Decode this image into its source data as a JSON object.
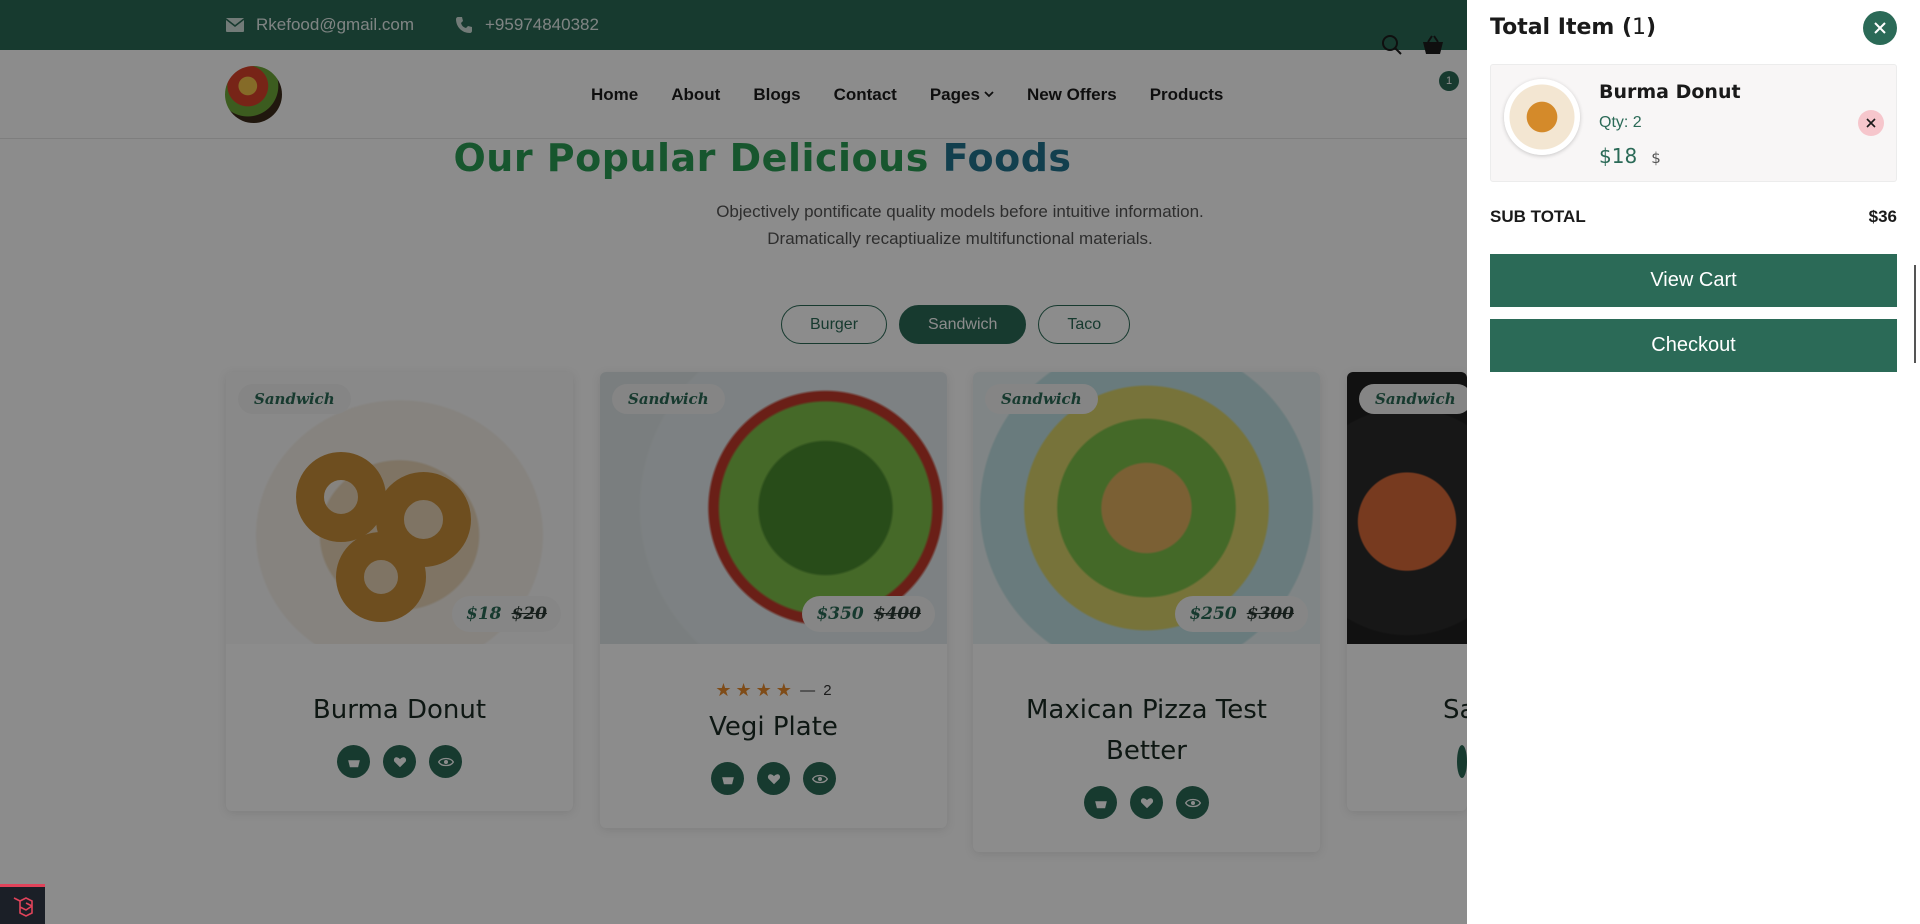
{
  "topbar": {
    "email": "Rkefood@gmail.com",
    "phone": "+95974840382"
  },
  "nav": [
    {
      "label": "Home"
    },
    {
      "label": "About"
    },
    {
      "label": "Blogs"
    },
    {
      "label": "Contact"
    },
    {
      "label": "Pages"
    },
    {
      "label": "New Offers"
    },
    {
      "label": "Products"
    }
  ],
  "header": {
    "cart_count": "1"
  },
  "section": {
    "title_part1": "Our Popular Delicious ",
    "title_part2": "Foods",
    "subtitle_line1": "Objectively pontificate quality models before intuitive information.",
    "subtitle_line2": "Dramatically recaptiualize multifunctional materials."
  },
  "filters": [
    {
      "label": "Burger"
    },
    {
      "label": "Sandwich"
    },
    {
      "label": "Taco"
    }
  ],
  "products": [
    {
      "tag": "Sandwich",
      "price": "$18",
      "old_price": "$20",
      "name": "Burma Donut",
      "rating_count": ""
    },
    {
      "tag": "Sandwich",
      "price": "$350",
      "old_price": "$400",
      "name": "Vegi Plate",
      "rating_count": "2"
    },
    {
      "tag": "Sandwich",
      "price": "$250",
      "old_price": "$300",
      "name": "Maxican Pizza Test Better",
      "rating_count": ""
    },
    {
      "tag": "Sandwich",
      "price": "",
      "old_price": "",
      "name": "Sa",
      "rating_count": ""
    }
  ],
  "cart": {
    "title": "Total Item (",
    "count": "1",
    "title_end": ")",
    "item_name": "Burma Donut",
    "item_qty": "Qty: 2",
    "item_price": "$18",
    "item_currency": "$",
    "subtotal_label": "SUB TOTAL",
    "subtotal_value": "$36",
    "view_cart": "View Cart",
    "checkout": "Checkout"
  },
  "colors": {
    "primary": "#2b6a57",
    "title_green": "#2a9d55",
    "title_blue": "#22748f",
    "star": "#e78a2c"
  }
}
